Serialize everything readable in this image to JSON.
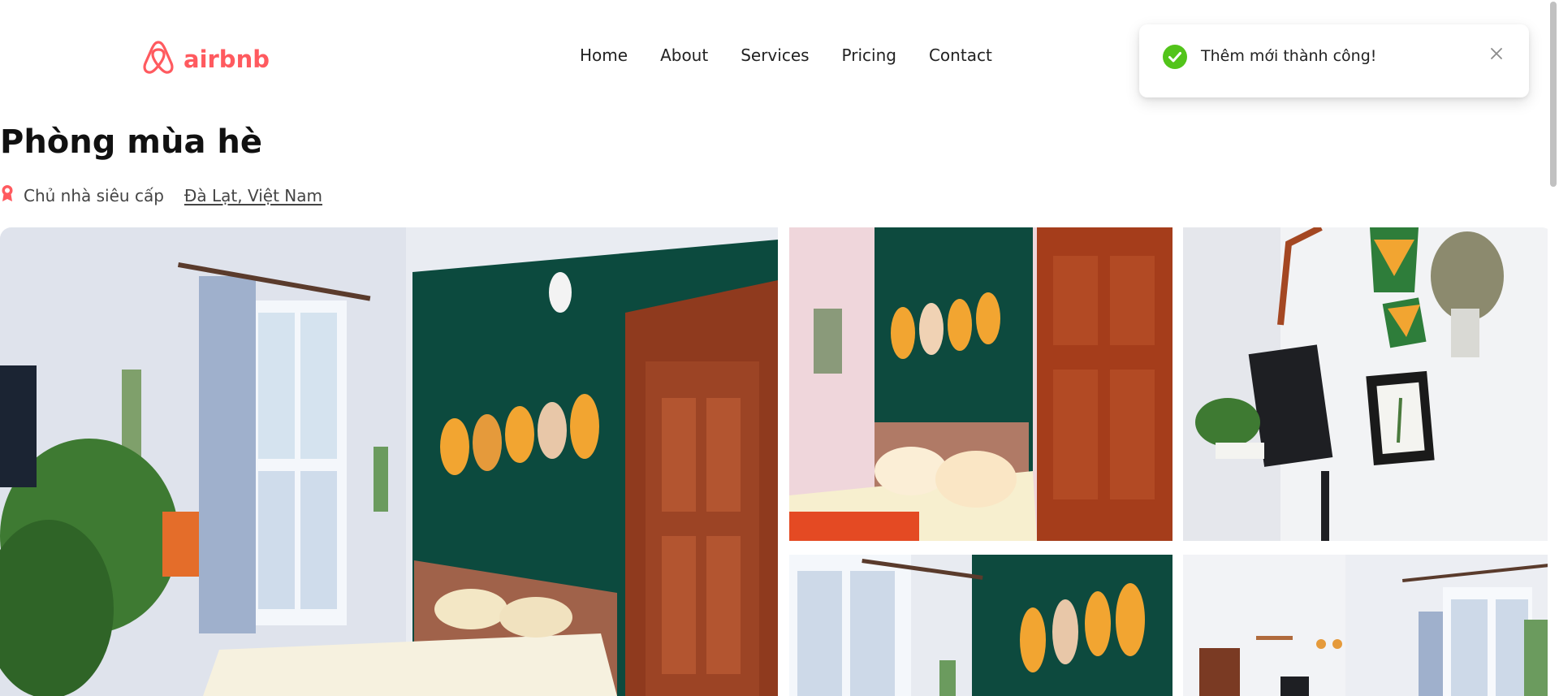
{
  "brand": {
    "name": "airbnb",
    "color": "#ff5a5f",
    "icon": "airbnb-logo-icon"
  },
  "nav": {
    "items": [
      {
        "label": "Home"
      },
      {
        "label": "About"
      },
      {
        "label": "Services"
      },
      {
        "label": "Pricing"
      },
      {
        "label": "Contact"
      }
    ]
  },
  "toast": {
    "message": "Thêm mới thành công!",
    "status": "success",
    "status_color": "#52c41a",
    "icon": "check-circle-icon",
    "close_icon": "close-icon"
  },
  "listing": {
    "title": "Phòng mùa hè",
    "host_badge_icon": "superhost-badge-icon",
    "host_label": "Chủ nhà siêu cấp",
    "location": "Đà Lạt, Việt Nam"
  },
  "gallery": {
    "photos": [
      {
        "name": "main-bedroom-photo"
      },
      {
        "name": "bed-leaf-wall-photo"
      },
      {
        "name": "tv-wall-decor-photo"
      },
      {
        "name": "green-wall-window-photo"
      },
      {
        "name": "room-overview-photo"
      }
    ]
  }
}
